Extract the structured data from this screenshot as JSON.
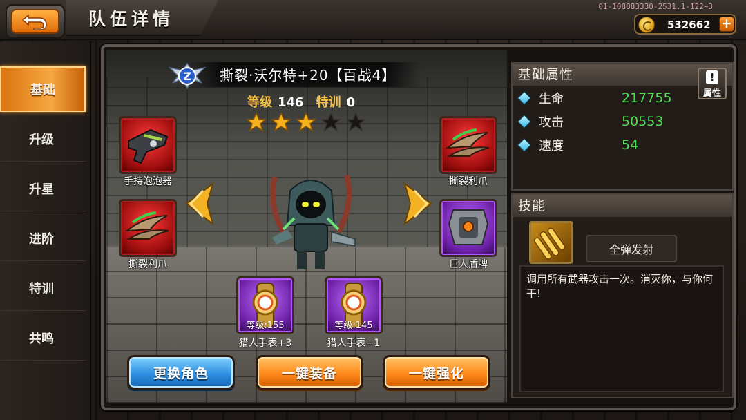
{
  "header": {
    "title": "队伍详情",
    "build_id": "01-108883330-2531.1-122~3",
    "gold": "532662",
    "add_gold_symbol": "+"
  },
  "sidebar": {
    "items": [
      {
        "label": "基础",
        "active": true
      },
      {
        "label": "升级",
        "active": false
      },
      {
        "label": "升星",
        "active": false
      },
      {
        "label": "进阶",
        "active": false
      },
      {
        "label": "特训",
        "active": false
      },
      {
        "label": "共鸣",
        "active": false
      }
    ]
  },
  "hero": {
    "rank_letter": "Z",
    "name": "撕裂·沃尔特+20【百战4】",
    "level_label": "等级",
    "level_value": "146",
    "training_label": "特训",
    "training_value": "0",
    "stars_filled": 3,
    "stars_total": 5
  },
  "equipment": {
    "left_top": {
      "label": "手持泡泡器",
      "rarity": "red",
      "icon": "bubble-gun-icon"
    },
    "left_bottom": {
      "label": "撕裂利爪",
      "rarity": "red",
      "icon": "claw-icon"
    },
    "right_top": {
      "label": "撕裂利爪",
      "rarity": "red",
      "icon": "claw-icon"
    },
    "right_bottom": {
      "label": "巨人盾牌",
      "rarity": "purple",
      "icon": "giant-shield-icon"
    }
  },
  "accessories": [
    {
      "level_text": "等级:155",
      "label": "猎人手表+3",
      "icon": "watch-icon"
    },
    {
      "level_text": "等级:145",
      "label": "猎人手表+1",
      "icon": "watch-icon"
    }
  ],
  "actions": {
    "change_role": "更换角色",
    "equip_all": "一键装备",
    "enhance_all": "一键强化"
  },
  "attributes": {
    "title": "基础属性",
    "info_icon": "!",
    "info_label": "属性",
    "stats": [
      {
        "name": "生命",
        "value": "217755"
      },
      {
        "name": "攻击",
        "value": "50553"
      },
      {
        "name": "速度",
        "value": "54"
      }
    ]
  },
  "skill": {
    "title": "技能",
    "icon": "bullets-icon",
    "name": "全弹发射",
    "description": "调用所有武器攻击一次。消灭你，与你何干!"
  },
  "colors": {
    "accent_orange": "#f7a742",
    "stat_green": "#50e054",
    "gold_text": "#f5c14a",
    "rarity_red": "#c41414",
    "rarity_purple": "#8a2fd0"
  }
}
